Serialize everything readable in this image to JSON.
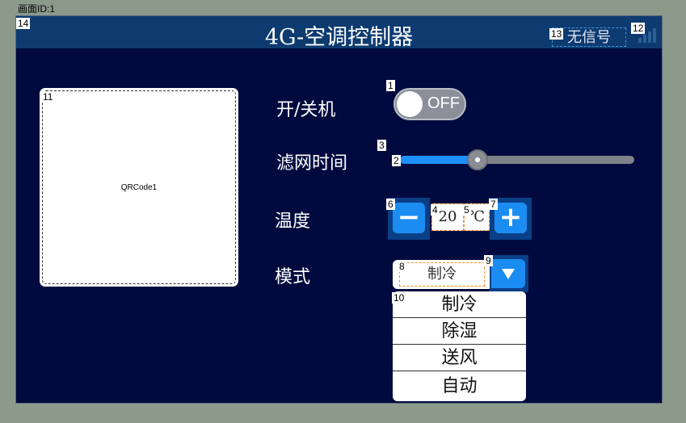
{
  "page": {
    "id_label": "画面ID:1"
  },
  "header": {
    "title": "4G-空调控制器",
    "signal_text": "无信号"
  },
  "qrcode": {
    "label": "QRCode1"
  },
  "power": {
    "label": "开/关机",
    "state_text": "OFF"
  },
  "filter": {
    "label": "滤网时间",
    "value_fraction": 0.33
  },
  "temperature": {
    "label": "温度",
    "value": "20",
    "unit": "℃",
    "minus": "−",
    "plus": "+"
  },
  "mode": {
    "label": "模式",
    "selected": "制冷",
    "options": [
      "制冷",
      "除湿",
      "送风",
      "自动"
    ]
  },
  "tags": [
    "1",
    "2",
    "3",
    "4",
    "5",
    "6",
    "7",
    "8",
    "9",
    "10",
    "11",
    "12",
    "13",
    "14"
  ],
  "colors": {
    "screen_bg": "#010a3e",
    "title_bar": "#0d3b70",
    "accent": "#1b8df2"
  }
}
